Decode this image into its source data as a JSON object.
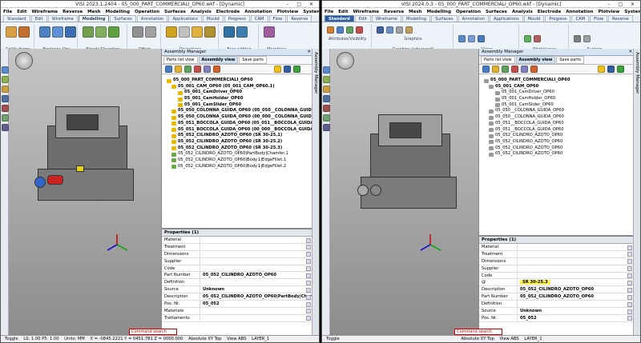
{
  "window_left": {
    "title": "VISI 2023.1.2404 - 05_000_PART_COMMERCIALI_OP60.wkf - [Dynamic]",
    "menu": [
      "File",
      "Edit",
      "Wireframe",
      "Reverse",
      "Mesh",
      "Modelling",
      "Operation",
      "Surfaces",
      "Analysis",
      "Electrode",
      "Annotation",
      "Plotview",
      "System",
      "Machining",
      "Mould",
      "Progress",
      "Standard elements",
      "Flow",
      "?"
    ],
    "tabs": [
      "Standard",
      "Edit",
      "Wireframe",
      "Modelling",
      "Surfaces",
      "Annotation",
      "Applications",
      "Mould",
      "Progress",
      "CAM",
      "Flow",
      "Reverse"
    ],
    "active_tab": "Modelling",
    "ribbon_groups": [
      "Solids forms",
      "Booleans Ops",
      "Blends/Chamfers",
      "Offset",
      "Operations",
      "Face editing",
      "Morphing"
    ],
    "assembly": {
      "title": "Assembly Manager",
      "view_tabs": [
        "Parts list view",
        "Assembly view",
        "Save parts"
      ],
      "tree": [
        {
          "text": "05_000_PART_COMMERCIALI_OP60",
          "bold": true,
          "color": "#e8b800"
        },
        {
          "text": "05_001_CAM_OP60 (05_001_CAM_OP60.1)",
          "bold": true,
          "color": "#e8b800"
        },
        {
          "text": "05_001_CamDriver_OP60",
          "bold": true,
          "color": "#e8b800"
        },
        {
          "text": "05_001_CamHolder_OP60",
          "bold": true,
          "color": "#e8b800"
        },
        {
          "text": "05_001_CamSlider_OP60",
          "bold": true,
          "color": "#e8b800"
        },
        {
          "text": "05_050_COLONNA_GUIDA_OP60 (05_050__COLONNA_GUIDA_OP60",
          "bold": true,
          "color": "#e8b800"
        },
        {
          "text": "05_050_COLONNA_GUIDA_OP60 (00_000__COLONNA_GUIDA PREMI",
          "bold": true,
          "color": "#e8b800"
        },
        {
          "text": "05_051_BOCCOLA_GUIDA_OP60 (05_051__BOCCOLA_GUIDA_OP60.",
          "bold": true,
          "color": "#e8b800"
        },
        {
          "text": "05_051_BOCCOLA_GUIDA_OP60 (00_000__BOCCOLA_GUIDA PREMII",
          "bold": true,
          "color": "#e8b800"
        },
        {
          "text": "05_052_CILINDRO_AZOTO_OP60 (SR 30-25.1)",
          "bold": true,
          "color": "#e8b800"
        },
        {
          "text": "05_052_CILINDRO_AZOTO_OP60 (SR 30-25.2)",
          "bold": true,
          "color": "#e8b800"
        },
        {
          "text": "05_052_CILINDRO_AZOTO_OP60 (SR 30-25.3)",
          "bold": true,
          "color": "#e8b800"
        },
        {
          "text": "05_052_CILINDRO_AZOTO_OP60|PartBody|Chamfer.1",
          "bold": false,
          "color": "#6aaa44"
        },
        {
          "text": "05_052_CILINDRO_AZOTO_OP60|Body.1|EdgeFillet.1",
          "bold": false,
          "color": "#6aaa44"
        },
        {
          "text": "05_052_CILINDRO_AZOTO_OP60|Body.1|EdgeFillet.2",
          "bold": false,
          "color": "#6aaa44"
        }
      ]
    },
    "properties": {
      "title": "Properties (1)",
      "rows": [
        {
          "k": "Material",
          "v": ""
        },
        {
          "k": "Treatment",
          "v": ""
        },
        {
          "k": "Dimensions",
          "v": ""
        },
        {
          "k": "Supplier",
          "v": ""
        },
        {
          "k": "Code",
          "v": ""
        },
        {
          "k": "Part Number",
          "v": "05_052_CILINDRO_AZOTO_OP60"
        },
        {
          "k": "Definition",
          "v": ""
        },
        {
          "k": "Source",
          "v": "Unknown"
        },
        {
          "k": "Description",
          "v": "05_052_CILINDRO_AZOTO_OP60|PartBody|Chamfer"
        },
        {
          "k": "Pos. Nr.",
          "v": "05_052"
        },
        {
          "k": "Materiale",
          "v": ""
        },
        {
          "k": "Trattamento",
          "v": ""
        }
      ]
    },
    "right_strip": "Assembly Manager",
    "status": {
      "toggle": "Toggle",
      "ls": "LS: 1.00 P5: 1.00",
      "units": "Units: MM",
      "coords": "X = -0845.2221 Y = 0451.781 Z = 0000.000",
      "cmd": "Command search",
      "absolute": "Absolute XY Top",
      "view": "View ABS",
      "layer": "LAYER_1"
    }
  },
  "window_right": {
    "title": "VISI 2024.0.3 - 05_000_PART_COMMERCIALI_OP60.wkf - [Dynamic]",
    "menu": [
      "File",
      "Edit",
      "Wireframe",
      "Reverse",
      "Mesh",
      "Modelling",
      "Operation",
      "Surfaces",
      "Analysis",
      "Electrode",
      "Annotation",
      "Plotview",
      "System",
      "Window",
      "Machining",
      "Mould",
      "Progress",
      "Standard elements",
      "Flow",
      "?",
      "TEST",
      "Spy"
    ],
    "tabs": [
      "Standard",
      "Edit",
      "Wireframe",
      "Modelling",
      "Surfaces",
      "Annotation",
      "Applications",
      "Mould",
      "Progress",
      "CAM",
      "Flow",
      "Reverse"
    ],
    "active_tab": "Standard",
    "ribbon_groups": [
      "Attributes/Visibility",
      "Graphics",
      "Graphics (advanced)",
      "Views",
      "Workplanes",
      "System"
    ],
    "assembly": {
      "title": "Assembly Manager",
      "view_tabs": [
        "Parts list view",
        "Assembly view",
        "Save parts"
      ],
      "tree": [
        {
          "text": "05_000_PART_COMMERCIALI_OP60",
          "bold": true,
          "color": "#999999"
        },
        {
          "text": "05_001_CAM_OP60",
          "bold": true,
          "color": "#999999"
        },
        {
          "text": "05_001_CamDriver_OP60",
          "bold": false,
          "color": "#999999"
        },
        {
          "text": "05_001_CamHolder_OP60",
          "bold": false,
          "color": "#999999"
        },
        {
          "text": "05_001_CamSlider_OP60",
          "bold": false,
          "color": "#999999"
        },
        {
          "text": "05_050__COLONNA_GUIDA_OP60",
          "bold": false,
          "color": "#999999"
        },
        {
          "text": "05_050__COLONNA_GUIDA_OP60",
          "bold": false,
          "color": "#999999"
        },
        {
          "text": "05_051__BOCCOLA_GUIDA_OP60",
          "bold": false,
          "color": "#999999"
        },
        {
          "text": "05_051__BOCCOLA_GUIDA_OP60",
          "bold": false,
          "color": "#999999"
        },
        {
          "text": "05_052_CILINDRO_AZOTO_OP60",
          "bold": false,
          "color": "#999999"
        },
        {
          "text": "05_052_CILINDRO_AZOTO_OP60",
          "bold": false,
          "color": "#999999"
        },
        {
          "text": "05_052_CILINDRO_AZOTO_OP60",
          "bold": false,
          "color": "#999999"
        },
        {
          "text": "05_052_CILINDRO_AZOTO_OP60",
          "bold": false,
          "color": "#999999"
        }
      ]
    },
    "properties": {
      "title": "Properties (1)",
      "rows": [
        {
          "k": "Material",
          "v": ""
        },
        {
          "k": "Treatment",
          "v": ""
        },
        {
          "k": "Dimensions",
          "v": ""
        },
        {
          "k": "Supplier",
          "v": ""
        },
        {
          "k": "Code",
          "v": ""
        },
        {
          "k": "@",
          "v": "SR 30-25.3",
          "hl": true
        },
        {
          "k": "Description",
          "v": "05_052_CILINDRO_AZOTO_OP60"
        },
        {
          "k": "Part Number",
          "v": "05_052_CILINDRO_AZOTO_OP60"
        },
        {
          "k": "Definition",
          "v": ""
        },
        {
          "k": "Source",
          "v": "Unknown"
        },
        {
          "k": "Pos. Nr.",
          "v": "05_052"
        }
      ]
    },
    "right_strip": "Assembly Manager",
    "status": {
      "toggle": "Toggle",
      "cmd": "Command search",
      "absolute": "Absolute XY Top",
      "view": "View ABS",
      "layer": "LAYER_1"
    }
  }
}
